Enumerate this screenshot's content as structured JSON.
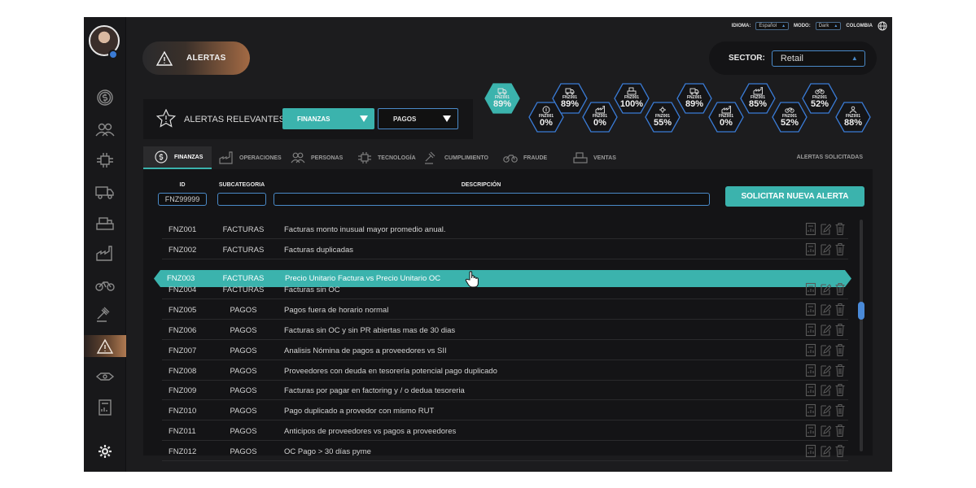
{
  "header": {
    "alert_label": "ALERTAS",
    "topbar": {
      "idioma_label": "IDIOMA:",
      "idioma_value": "Español",
      "modo_label": "MODO:",
      "modo_value": "Dark",
      "country": "COLOMBIA"
    },
    "sector_label": "SECTOR:",
    "sector_value": "Retail"
  },
  "relevant": {
    "label": "ALERTAS RELEVANTES",
    "select1": "FINANZAS",
    "select2": "PAGOS"
  },
  "hexes": [
    {
      "code": "FNZ001",
      "pct": "89%",
      "icon": "truck-icon",
      "active": true
    },
    {
      "code": "FNZ001",
      "pct": "0%",
      "icon": "coin-icon"
    },
    {
      "code": "FNZ001",
      "pct": "89%",
      "icon": "truck-icon"
    },
    {
      "code": "FNZ001",
      "pct": "0%",
      "icon": "factory-icon"
    },
    {
      "code": "FNZ001",
      "pct": "100%",
      "icon": "register-icon"
    },
    {
      "code": "FNZ001",
      "pct": "55%",
      "icon": "network-icon"
    },
    {
      "code": "FNZ001",
      "pct": "89%",
      "icon": "truck-icon"
    },
    {
      "code": "FNZ001",
      "pct": "0%",
      "icon": "factory-icon"
    },
    {
      "code": "FNZ001",
      "pct": "85%",
      "icon": "factory-icon"
    },
    {
      "code": "FNZ001",
      "pct": "52%",
      "icon": "bike-icon"
    },
    {
      "code": "FNZ001",
      "pct": "52%",
      "icon": "bike-icon"
    },
    {
      "code": "FNZ001",
      "pct": "88%",
      "icon": "people-icon"
    }
  ],
  "tabs": [
    {
      "label": "FINANZAS",
      "icon": "dollar-icon"
    },
    {
      "label": "OPERACIONES",
      "icon": "factory-icon"
    },
    {
      "label": "PERSONAS",
      "icon": "people-icon"
    },
    {
      "label": "TECNOLOGÍA",
      "icon": "circuit-icon"
    },
    {
      "label": "CUMPLIMIENTO",
      "icon": "gavel-icon"
    },
    {
      "label": "FRAUDE",
      "icon": "bike-icon"
    },
    {
      "label": "VENTAS",
      "icon": "register-icon"
    }
  ],
  "tabs_right": "ALERTAS SOLICITADAS",
  "table": {
    "headers": {
      "id": "ID",
      "sub": "SUBCATEGORIA",
      "desc": "DESCRIPCIÓN"
    },
    "filter_id": "FNZ99999",
    "new_alert": "SOLICITAR NUEVA ALERTA",
    "rows": [
      {
        "id": "FNZ001",
        "sub": "FACTURAS",
        "desc": "Facturas monto inusual mayor promedio anual."
      },
      {
        "id": "FNZ002",
        "sub": "FACTURAS",
        "desc": "Facturas duplicadas"
      },
      {
        "id": "FNZ003",
        "sub": "FACTURAS",
        "desc": "Precio Unitario Factura vs Precio Unitario OC",
        "selected": true
      },
      {
        "id": "FNZ004",
        "sub": "FACTURAS",
        "desc": "Facturas sin OC"
      },
      {
        "id": "FNZ005",
        "sub": "PAGOS",
        "desc": "Pagos fuera de horario normal"
      },
      {
        "id": "FNZ006",
        "sub": "PAGOS",
        "desc": "Facturas sin OC y sin PR abiertas mas de 30 dias"
      },
      {
        "id": "FNZ007",
        "sub": "PAGOS",
        "desc": "Analisis Nómina de pagos a proveedores vs SII"
      },
      {
        "id": "FNZ008",
        "sub": "PAGOS",
        "desc": "Proveedores con deuda en tesorería potencial pago duplicado"
      },
      {
        "id": "FNZ009",
        "sub": "PAGOS",
        "desc": "Facturas por pagar en factoring y / o dedua tesoreria"
      },
      {
        "id": "FNZ010",
        "sub": "PAGOS",
        "desc": "Pago duplicado a provedor con mismo RUT"
      },
      {
        "id": "FNZ011",
        "sub": "PAGOS",
        "desc": "Anticipos de proveedores vs pagos a proveedores"
      },
      {
        "id": "FNZ012",
        "sub": "PAGOS",
        "desc": "OC Pago > 30 días pyme"
      }
    ]
  },
  "colors": {
    "accent": "#3bb3ad",
    "blue": "#4a8ac8",
    "bg": "#1c1c1e",
    "orange": "#b07a52"
  }
}
